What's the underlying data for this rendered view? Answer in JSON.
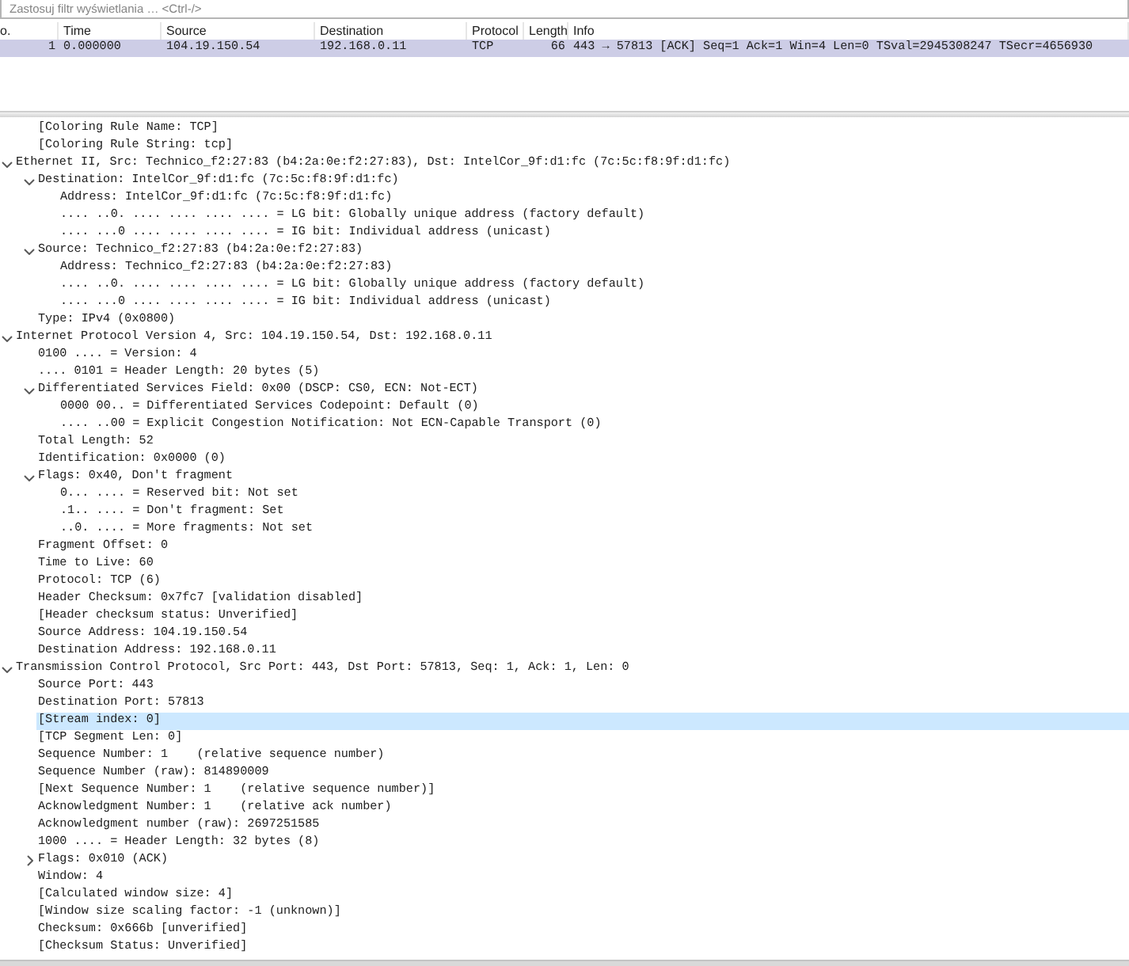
{
  "filter": {
    "placeholder": "Zastosuj filtr wyświetlania … <Ctrl-/>"
  },
  "packet_list": {
    "columns": [
      "o.",
      "Time",
      "Source",
      "Destination",
      "Protocol",
      "Length",
      "Info"
    ],
    "rows": [
      {
        "selected": false,
        "cells": [
          "1",
          "0.000000",
          "104.19.150.54",
          "192.168.0.11",
          "TCP",
          "66",
          "443 → 57813 [ACK] Seq=1 Ack=1 Win=4 Len=0 TSval=2945308247 TSecr=4656930"
        ]
      }
    ]
  },
  "details": [
    {
      "children": [
        {
          "text": "[Coloring Rule Name: TCP]",
          "selected": false
        },
        {
          "text": "[Coloring Rule String: tcp]",
          "selected": false
        }
      ]
    },
    {
      "text": "Ethernet II, Src: Technico_f2:27:83 (b4:2a:0e:f2:27:83), Dst: IntelCor_9f:d1:fc (7c:5c:f8:9f:d1:fc)",
      "selected": false,
      "expanded": true,
      "children": [
        {
          "text": "Destination: IntelCor_9f:d1:fc (7c:5c:f8:9f:d1:fc)",
          "selected": false,
          "expanded": true,
          "children": [
            {
              "text": "Address: IntelCor_9f:d1:fc (7c:5c:f8:9f:d1:fc)",
              "selected": false
            },
            {
              "text": ".... ..0. .... .... .... .... = LG bit: Globally unique address (factory default)",
              "selected": false
            },
            {
              "text": ".... ...0 .... .... .... .... = IG bit: Individual address (unicast)",
              "selected": false
            }
          ]
        },
        {
          "text": "Source: Technico_f2:27:83 (b4:2a:0e:f2:27:83)",
          "selected": false,
          "expanded": true,
          "children": [
            {
              "text": "Address: Technico_f2:27:83 (b4:2a:0e:f2:27:83)",
              "selected": false
            },
            {
              "text": ".... ..0. .... .... .... .... = LG bit: Globally unique address (factory default)",
              "selected": false
            },
            {
              "text": ".... ...0 .... .... .... .... = IG bit: Individual address (unicast)",
              "selected": false
            }
          ]
        },
        {
          "text": "Type: IPv4 (0x0800)",
          "selected": false
        }
      ]
    },
    {
      "text": "Internet Protocol Version 4, Src: 104.19.150.54, Dst: 192.168.0.11",
      "selected": false,
      "expanded": true,
      "children": [
        {
          "text": "0100 .... = Version: 4",
          "selected": false
        },
        {
          "text": ".... 0101 = Header Length: 20 bytes (5)",
          "selected": false
        },
        {
          "text": "Differentiated Services Field: 0x00 (DSCP: CS0, ECN: Not-ECT)",
          "selected": false,
          "expanded": true,
          "children": [
            {
              "text": "0000 00.. = Differentiated Services Codepoint: Default (0)",
              "selected": false
            },
            {
              "text": ".... ..00 = Explicit Congestion Notification: Not ECN-Capable Transport (0)",
              "selected": false
            }
          ]
        },
        {
          "text": "Total Length: 52",
          "selected": false
        },
        {
          "text": "Identification: 0x0000 (0)",
          "selected": false
        },
        {
          "text": "Flags: 0x40, Don't fragment",
          "selected": false,
          "expanded": true,
          "children": [
            {
              "text": "0... .... = Reserved bit: Not set",
              "selected": false
            },
            {
              "text": ".1.. .... = Don't fragment: Set",
              "selected": false
            },
            {
              "text": "..0. .... = More fragments: Not set",
              "selected": false
            }
          ]
        },
        {
          "text": "Fragment Offset: 0",
          "selected": false
        },
        {
          "text": "Time to Live: 60",
          "selected": false
        },
        {
          "text": "Protocol: TCP (6)",
          "selected": false
        },
        {
          "text": "Header Checksum: 0x7fc7 [validation disabled]",
          "selected": false
        },
        {
          "text": "[Header checksum status: Unverified]",
          "selected": false
        },
        {
          "text": "Source Address: 104.19.150.54",
          "selected": false
        },
        {
          "text": "Destination Address: 192.168.0.11",
          "selected": false
        }
      ]
    },
    {
      "text": "Transmission Control Protocol, Src Port: 443, Dst Port: 57813, Seq: 1, Ack: 1, Len: 0",
      "selected": false,
      "expanded": true,
      "children": [
        {
          "text": "Source Port: 443",
          "selected": false
        },
        {
          "text": "Destination Port: 57813",
          "selected": false
        },
        {
          "text": "[Stream index: 0]",
          "selected": true
        },
        {
          "text": "[TCP Segment Len: 0]",
          "selected": false
        },
        {
          "text": "Sequence Number: 1    (relative sequence number)",
          "selected": false
        },
        {
          "text": "Sequence Number (raw): 814890009",
          "selected": false
        },
        {
          "text": "[Next Sequence Number: 1    (relative sequence number)]",
          "selected": false
        },
        {
          "text": "Acknowledgment Number: 1    (relative ack number)",
          "selected": false
        },
        {
          "text": "Acknowledgment number (raw): 2697251585",
          "selected": false
        },
        {
          "text": "1000 .... = Header Length: 32 bytes (8)",
          "selected": false
        },
        {
          "text": "Flags: 0x010 (ACK)",
          "selected": false,
          "expanded": false
        },
        {
          "text": "Window: 4",
          "selected": false
        },
        {
          "text": "[Calculated window size: 4]",
          "selected": false
        },
        {
          "text": "[Window size scaling factor: -1 (unknown)]",
          "selected": false
        },
        {
          "text": "Checksum: 0x666b [unverified]",
          "selected": false
        },
        {
          "text": "[Checksum Status: Unverified]",
          "selected": false
        }
      ]
    }
  ]
}
